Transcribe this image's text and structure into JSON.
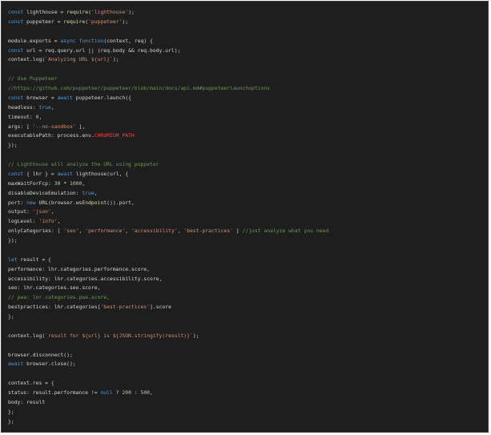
{
  "editor": {
    "colors": {
      "background": "#1e1e1e",
      "plain": "#d4d4d4",
      "keyword": "#569cd6",
      "string": "#ce9178",
      "number": "#b5cea8",
      "comment": "#6a9955",
      "function": "#dcdcaa",
      "constant": "#f44747"
    },
    "lines": [
      [
        [
          "kw",
          "const"
        ],
        [
          "plain",
          " lighthouse = "
        ],
        [
          "fn",
          "require"
        ],
        [
          "plain",
          "("
        ],
        [
          "str",
          "'lighthouse'"
        ],
        [
          "plain",
          ");"
        ]
      ],
      [
        [
          "kw",
          "const"
        ],
        [
          "plain",
          " puppeteer = "
        ],
        [
          "fn",
          "require"
        ],
        [
          "plain",
          "("
        ],
        [
          "str",
          "'puppeteer'"
        ],
        [
          "plain",
          ");"
        ]
      ],
      [],
      [
        [
          "plain",
          "module.exports = "
        ],
        [
          "kw",
          "async"
        ],
        [
          "plain",
          " "
        ],
        [
          "kw",
          "function"
        ],
        [
          "plain",
          "(context, req) {"
        ]
      ],
      [
        [
          "kw",
          "const"
        ],
        [
          "plain",
          " url = req.query.url || (req.body && req.body.url);"
        ]
      ],
      [
        [
          "plain",
          "context.log("
        ],
        [
          "str",
          "`Analyzing URL ${url}`"
        ],
        [
          "plain",
          ");"
        ]
      ],
      [],
      [
        [
          "com",
          "// Use Puppeteer"
        ]
      ],
      [
        [
          "com",
          "//https://github.com/puppeteer/puppeteer/blob/main/docs/api.md#puppeteerlaunchoptions"
        ]
      ],
      [
        [
          "kw",
          "const"
        ],
        [
          "plain",
          " browser = "
        ],
        [
          "kw",
          "await"
        ],
        [
          "plain",
          " puppeteer.launch({"
        ]
      ],
      [
        [
          "plain",
          "headless: "
        ],
        [
          "kw",
          "true"
        ],
        [
          "plain",
          ","
        ]
      ],
      [
        [
          "plain",
          "timeout: "
        ],
        [
          "num",
          "0"
        ],
        [
          "plain",
          ","
        ]
      ],
      [
        [
          "plain",
          "args: [ "
        ],
        [
          "str",
          "'--no-sandbox'"
        ],
        [
          "plain",
          " ],"
        ]
      ],
      [
        [
          "plain",
          "executablePath: process.env."
        ],
        [
          "const",
          "CHROMIUM_PATH"
        ]
      ],
      [
        [
          "plain",
          "});"
        ]
      ],
      [],
      [
        [
          "com",
          "// Lighthouse will analyze the URL using puppeter"
        ]
      ],
      [
        [
          "kw",
          "const"
        ],
        [
          "plain",
          " { lhr } = "
        ],
        [
          "kw",
          "await"
        ],
        [
          "plain",
          " lighthouse(url, {"
        ]
      ],
      [
        [
          "plain",
          "maxWaitForFcp: "
        ],
        [
          "num",
          "30"
        ],
        [
          "plain",
          " * "
        ],
        [
          "num",
          "1000"
        ],
        [
          "plain",
          ","
        ]
      ],
      [
        [
          "plain",
          "disableDeviceEmulation: "
        ],
        [
          "kw",
          "true"
        ],
        [
          "plain",
          ","
        ]
      ],
      [
        [
          "plain",
          "port: "
        ],
        [
          "kw",
          "new"
        ],
        [
          "plain",
          " "
        ],
        [
          "fn",
          "URL"
        ],
        [
          "plain",
          "(browser."
        ],
        [
          "fn",
          "wsEndpoint"
        ],
        [
          "plain",
          "()).port,"
        ]
      ],
      [
        [
          "plain",
          "output: "
        ],
        [
          "str",
          "'json'"
        ],
        [
          "plain",
          ","
        ]
      ],
      [
        [
          "plain",
          "logLevel: "
        ],
        [
          "str",
          "'info'"
        ],
        [
          "plain",
          ","
        ]
      ],
      [
        [
          "plain",
          "onlyCategories: [ "
        ],
        [
          "str",
          "'seo'"
        ],
        [
          "plain",
          ", "
        ],
        [
          "str",
          "'performance'"
        ],
        [
          "plain",
          ", "
        ],
        [
          "str",
          "'accessibility'"
        ],
        [
          "plain",
          ", "
        ],
        [
          "str",
          "'best-practices'"
        ],
        [
          "plain",
          " ] "
        ],
        [
          "com",
          "//just analyze what you need"
        ]
      ],
      [
        [
          "plain",
          "});"
        ]
      ],
      [],
      [
        [
          "kw",
          "let"
        ],
        [
          "plain",
          " result = {"
        ]
      ],
      [
        [
          "plain",
          "performance: lhr.categories.performance.score,"
        ]
      ],
      [
        [
          "plain",
          "accessibility: lhr.categories.accessibility.score,"
        ]
      ],
      [
        [
          "plain",
          "seo: lhr.categories.seo.score,"
        ]
      ],
      [
        [
          "com",
          "// pwa: lhr.categories.pwa.score,"
        ]
      ],
      [
        [
          "plain",
          "bestpractices: lhr.categories["
        ],
        [
          "str",
          "'best-practices'"
        ],
        [
          "plain",
          "].score"
        ]
      ],
      [
        [
          "plain",
          "};"
        ]
      ],
      [],
      [
        [
          "plain",
          "context.log("
        ],
        [
          "str",
          "`result for ${url} is ${JSON.stringify(result)}`"
        ],
        [
          "plain",
          ");"
        ]
      ],
      [],
      [
        [
          "plain",
          "browser.disconnect();"
        ]
      ],
      [
        [
          "kw",
          "await"
        ],
        [
          "plain",
          " browser.close();"
        ]
      ],
      [],
      [
        [
          "plain",
          "context.res = {"
        ]
      ],
      [
        [
          "plain",
          "status: result.performance != "
        ],
        [
          "kw",
          "null"
        ],
        [
          "plain",
          " ? "
        ],
        [
          "num",
          "200"
        ],
        [
          "plain",
          " : "
        ],
        [
          "num",
          "500"
        ],
        [
          "plain",
          ","
        ]
      ],
      [
        [
          "plain",
          "body: result"
        ]
      ],
      [
        [
          "plain",
          "};"
        ]
      ],
      [
        [
          "plain",
          "};"
        ]
      ]
    ]
  }
}
